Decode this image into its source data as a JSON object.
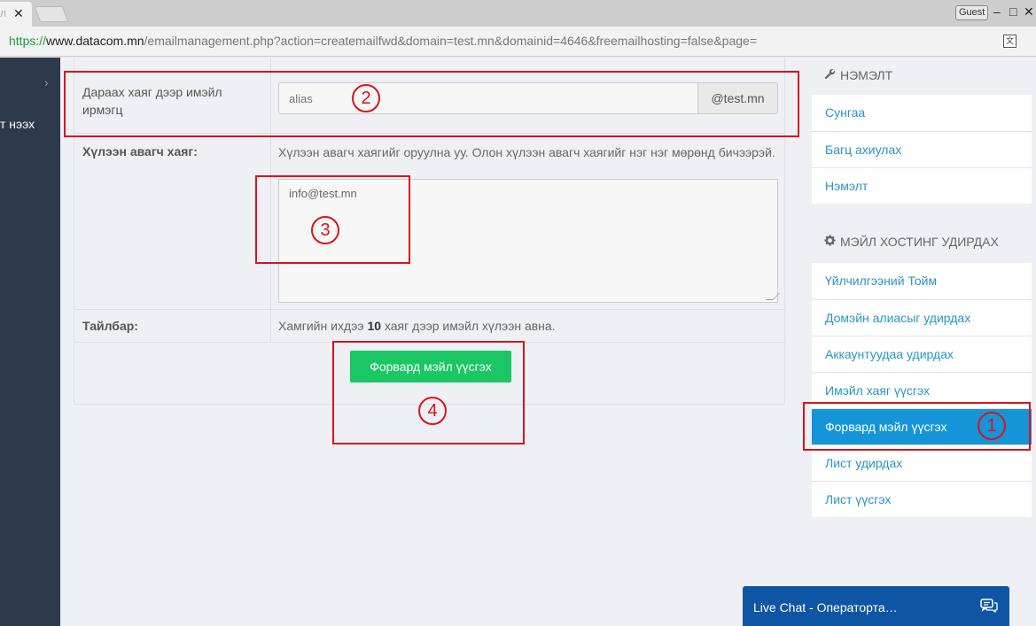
{
  "browser": {
    "tab_close": "✕",
    "tab_fragment": "л",
    "guest_label": "Guest",
    "minimize": "–",
    "maximize": "□",
    "close": "✕",
    "url_scheme": "https://",
    "url_host": "www.datacom.mn",
    "url_path": "/emailmanagement.php?action=createmailfwd&domain=test.mn&domainid=4646&freemailhosting=false&page=",
    "translate_icon": "文"
  },
  "leftnav": {
    "chevron": "›",
    "partial_text": "т нээх"
  },
  "form": {
    "alias_label": "Дараах хаяг дээр имэйл ирмэгц",
    "alias_placeholder": "alias",
    "domain_addon": "@test.mn",
    "targets_label": "Хүлээн авагч хаяг:",
    "targets_help": "Хүлээн авагч хаягийг оруулна уу. Олон хүлээн авагч хаягийг нэг нэг мөрөнд бичээрэй.",
    "targets_value": "info@test.mn",
    "note_label": "Тайлбар:",
    "note_prefix": "Хамгийн ихдээ ",
    "note_number": "10",
    "note_suffix": " хаяг дээр имэйл хүлээн авна.",
    "submit_label": "Форвард мэйл үүсгэх"
  },
  "sidebar": {
    "addons_title": "НЭМЭЛТ",
    "addons_icon": "wrench-icon",
    "addons_items": [
      "Сунгаа",
      "Багц ахиулах",
      "Нэмэлт"
    ],
    "manage_title": "МЭЙЛ ХОСТИНГ УДИРДАХ",
    "manage_icon": "gear-icon",
    "manage_items": [
      "Үйлчилгээний Тойм",
      "Домэйн алиасыг удирдах",
      "Аккаунтуудаа удирдах",
      "Имэйл хаяг үүсгэх",
      "Форвард мэйл үүсгэх",
      "Лист удирдах",
      "Лист үүсгэх"
    ],
    "active_item": "Форвард мэйл үүсгэх"
  },
  "chat": {
    "label": "Live Chat - Операторта…"
  },
  "annotations": {
    "color": "#d8141c",
    "numbers": [
      "1",
      "2",
      "3",
      "4"
    ]
  }
}
